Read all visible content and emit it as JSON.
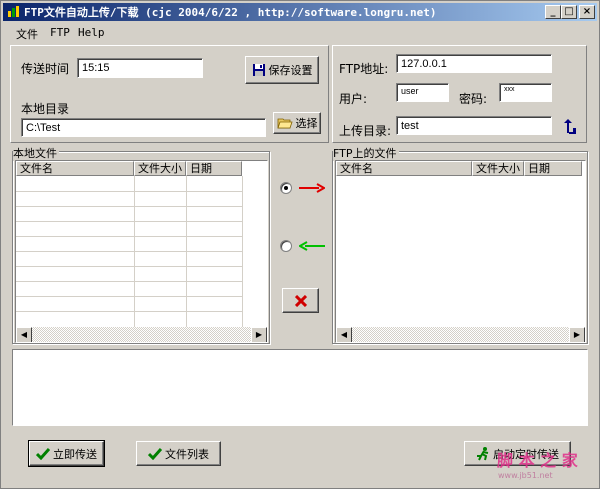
{
  "window": {
    "title": "FTP文件自动上传/下载   (cjc 2004/6/22 , http://software.longru.net)",
    "min_label": "_",
    "max_label": "□",
    "close_label": "×"
  },
  "menu": [
    "文件",
    "FTP",
    "Help"
  ],
  "local": {
    "interval_label": "传送时间",
    "interval_value": "15:15",
    "save_button": "保存设置",
    "dir_label": "本地目录",
    "dir_value": "C:\\Test",
    "browse_button": "选择"
  },
  "ftp": {
    "address_label": "FTP地址:",
    "address_value": "127.0.0.1",
    "user_label": "用户:",
    "user_value": "user",
    "password_label": "密码:",
    "password_value": "xxx",
    "upload_dir_label": "上传目录:",
    "upload_dir_value": "test"
  },
  "local_files": {
    "title": "本地文件",
    "columns": [
      "文件名",
      "文件大小",
      "日期"
    ]
  },
  "remote_files": {
    "title": "FTP上的文件",
    "columns": [
      "文件名",
      "文件大小",
      "日期"
    ]
  },
  "direction": {
    "upload_selected": true,
    "download_selected": false,
    "upload_arrow_color": "#e00000",
    "download_arrow_color": "#00c000"
  },
  "footer": {
    "send_now_button": "立即传送",
    "file_list_button": "文件列表",
    "timer_button": "启动定时传送"
  },
  "watermark": {
    "main": "脚 本 之 家",
    "url": "www.jb51.net"
  },
  "colors": {
    "title_start": "#0a246a",
    "title_end": "#a6caf0",
    "face": "#d4d0c8",
    "check_green": "#008000",
    "delete_red": "#d00000"
  }
}
